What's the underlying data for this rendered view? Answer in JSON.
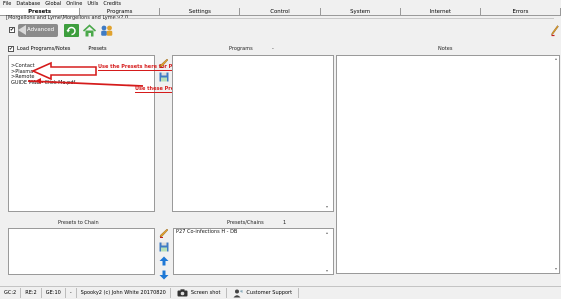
{
  "menu": [
    "File",
    "Database",
    "Global",
    "Online",
    "Utils",
    "Credits"
  ],
  "tabs": [
    "Presets",
    "Programs",
    "Settings",
    "Control",
    "System",
    "Internet",
    "Errors"
  ],
  "breadcrumb": "[Morgellons and Lyme\\Morgellons and Lyme v2.0",
  "advanced_label": "Advanced",
  "load_label": "Load Programs/Notes",
  "presets_header": "Presets",
  "programs_header": "Programs",
  "programs_header_suffix": "-",
  "notes_header": "Notes",
  "presets_list": [
    ">Contact",
    ">Plasma",
    ">Remote",
    "GUIDE M&L - Click Me.pdf"
  ],
  "annotation_plasma": "Use the Presets here for Plasma use...",
  "annotation_remote": "Use these Presets for Remote application!!!",
  "presets_to_chain_label": "Presets to Chain",
  "presets_chain_label": "Presets/Chains",
  "presets_chain_count": "1",
  "chain_items": [
    "P27 Co-infections H - DB"
  ],
  "status": {
    "gc": "GC:2",
    "re": "RE:2",
    "ge": "GE:10",
    "dash": "-",
    "credit": "Spooky2 (c) John White 20170820",
    "screenshot": "Screen shot",
    "support": "Customer Support"
  },
  "colors": {
    "annotation": "#d51b1b",
    "tab_active_bg": "#ffffff",
    "panel_border": "#9a9a9a"
  }
}
